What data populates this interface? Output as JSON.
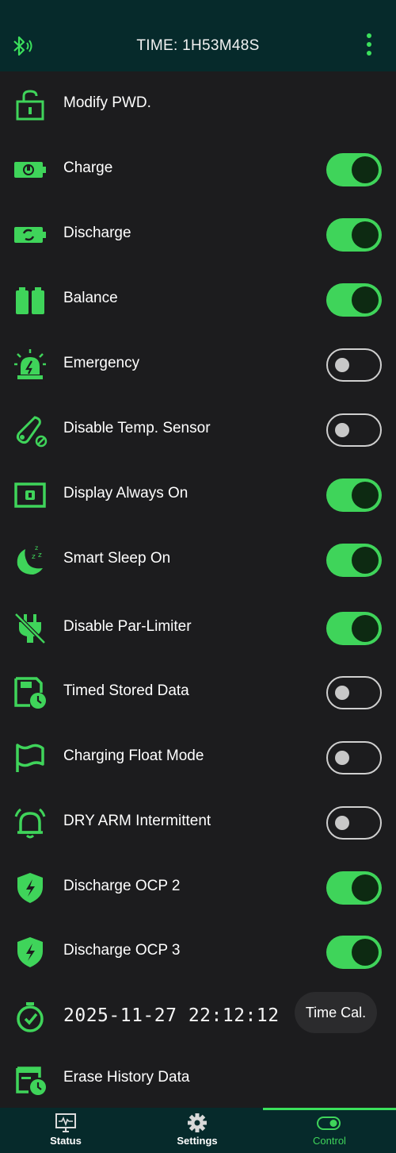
{
  "header": {
    "title": "TIME: 1H53M48S",
    "bluetooth_icon": "bluetooth-icon",
    "menu_icon": "more-vert-icon"
  },
  "colors": {
    "accent": "#3fd45a",
    "background": "#1c1c1e",
    "bar": "#062a2b"
  },
  "rows": [
    {
      "label": "Modify PWD.",
      "icon": "lock-icon"
    },
    {
      "label": "Charge",
      "icon": "battery-charge-icon",
      "toggle": "on"
    },
    {
      "label": "Discharge",
      "icon": "battery-cycle-icon",
      "toggle": "on"
    },
    {
      "label": "Balance",
      "icon": "battery-balance-icon",
      "toggle": "on"
    },
    {
      "label": "Emergency",
      "icon": "siren-icon",
      "toggle": "off"
    },
    {
      "label": "Disable Temp. Sensor",
      "icon": "temp-sensor-off-icon",
      "toggle": "off"
    },
    {
      "label": "Display Always On",
      "icon": "display-icon",
      "toggle": "on"
    },
    {
      "label": "Smart Sleep On",
      "icon": "moon-sleep-icon",
      "toggle": "on"
    },
    {
      "label": "Disable Par-Limiter",
      "icon": "plug-off-icon",
      "toggle": "on"
    },
    {
      "label": "Timed Stored Data",
      "icon": "save-clock-icon",
      "toggle": "off"
    },
    {
      "label": "Charging Float Mode",
      "icon": "flag-icon",
      "toggle": "off"
    },
    {
      "label": "DRY ARM Intermittent",
      "icon": "bell-icon",
      "toggle": "off"
    },
    {
      "label": "Discharge OCP 2",
      "icon": "shield-bolt-icon",
      "toggle": "on"
    },
    {
      "label": "Discharge OCP 3",
      "icon": "shield-bolt-icon",
      "toggle": "on"
    }
  ],
  "datetime": {
    "value": "2025-11-27 22:12:12",
    "button": "Time Cal.",
    "icon": "timer-icon"
  },
  "erase": {
    "label": "Erase History Data",
    "icon": "calendar-clock-icon"
  },
  "nav": {
    "tabs": [
      {
        "label": "Status",
        "icon": "monitor-icon"
      },
      {
        "label": "Settings",
        "icon": "gear-icon"
      },
      {
        "label": "Control",
        "icon": "toggle-icon",
        "active": true
      }
    ]
  }
}
